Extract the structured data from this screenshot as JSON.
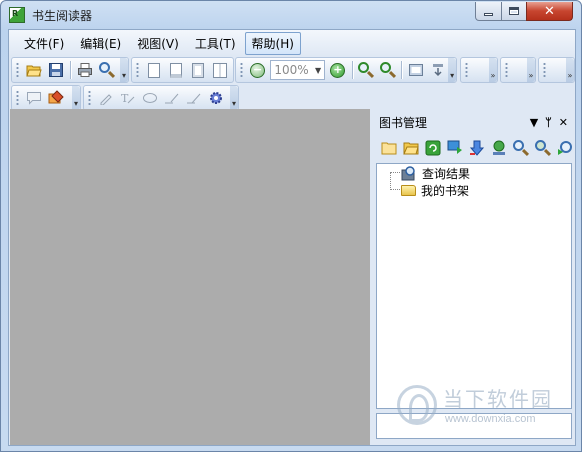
{
  "window": {
    "title": "书生阅读器",
    "controls": {
      "minimize": "minimize",
      "maximize": "maximize",
      "close": "✕"
    }
  },
  "menubar": {
    "items": [
      {
        "label": "文件(F)"
      },
      {
        "label": "编辑(E)"
      },
      {
        "label": "视图(V)"
      },
      {
        "label": "工具(T)"
      },
      {
        "label": "帮助(H)",
        "active": true
      }
    ]
  },
  "toolbar": {
    "zoom_value": "100%",
    "main_icons": [
      "open-folder-icon",
      "save-icon",
      "print-icon",
      "find-icon",
      "single-page-icon",
      "page-view-icon",
      "fit-page-icon",
      "two-page-icon",
      "zoom-out-icon",
      "zoom-in-plus-icon",
      "magnify-icon",
      "magnify-minus-icon",
      "window-icon",
      "download-icon"
    ],
    "annotation_icons": [
      "comment-icon",
      "highlighter-icon",
      "pen-icon",
      "text-tool-icon",
      "ellipse-icon",
      "line-icon",
      "underline-icon",
      "settings-gear-icon"
    ]
  },
  "panel": {
    "title": "图书管理",
    "header_controls": [
      "▼",
      "ᛘ",
      "✕"
    ],
    "tool_icons": [
      "new-folder-icon",
      "open-folder-icon",
      "refresh-icon",
      "download-arrow-icon",
      "move-down-icon",
      "globe-icon",
      "search-icon",
      "search-plus-icon",
      "export-icon"
    ],
    "tree": [
      {
        "label": "查询结果",
        "icon": "search-results-icon"
      },
      {
        "label": "我的书架",
        "icon": "folder-icon"
      }
    ]
  },
  "watermark": {
    "brand": "当下软件园",
    "url": "www.downxia.com"
  },
  "colors": {
    "doc_area": "#acacac",
    "client_bg": "#dfe8f4",
    "accent": "#3a6fb0",
    "close_button": "#c7452f"
  }
}
